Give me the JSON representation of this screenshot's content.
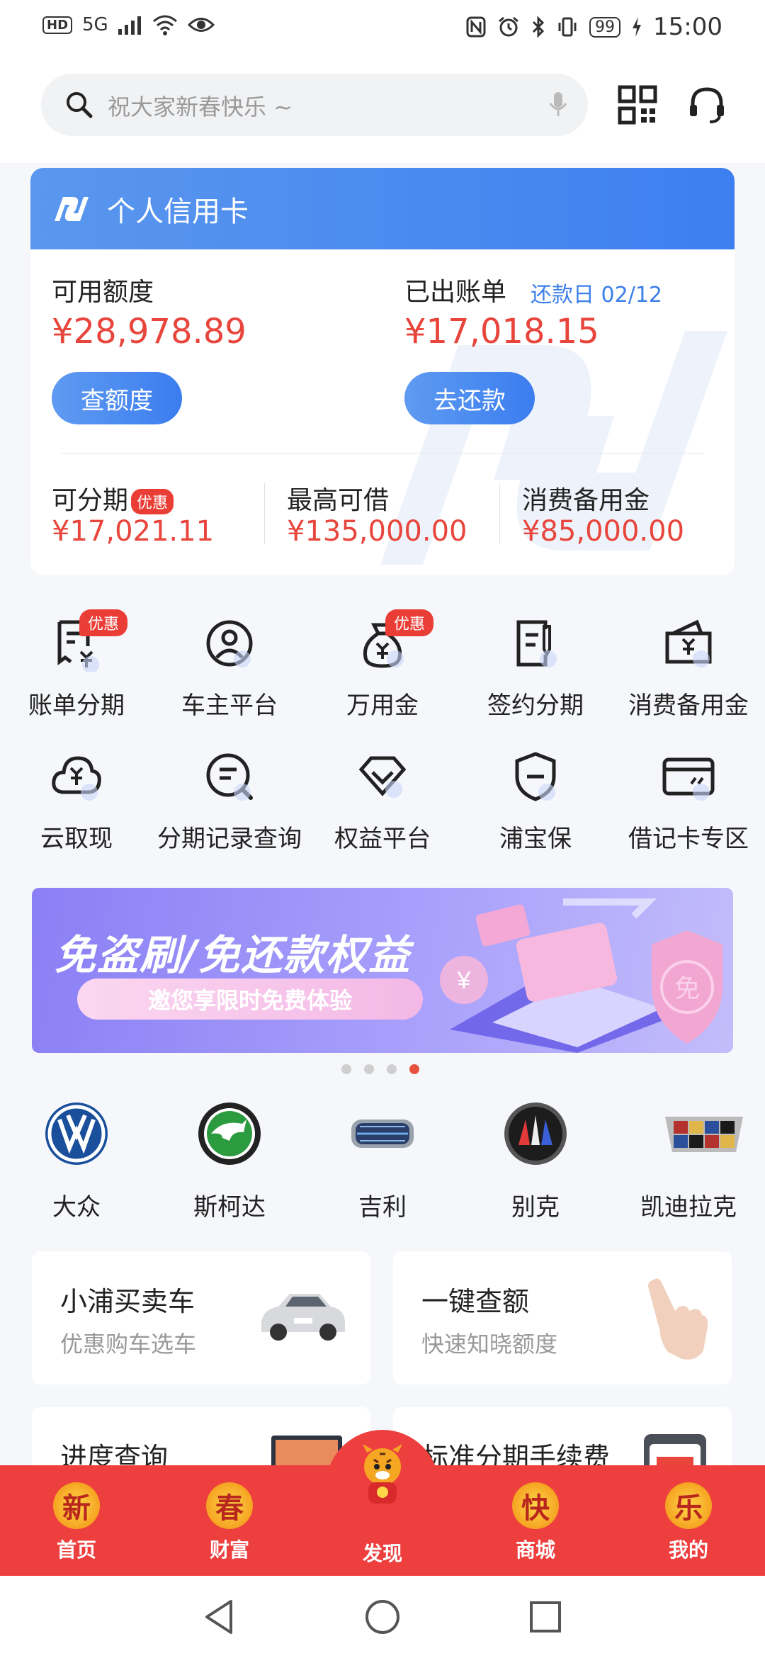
{
  "status_bar": {
    "hd_label": "HD",
    "network_label": "5G",
    "battery": "99",
    "time": "15:00"
  },
  "search": {
    "placeholder": "祝大家新春快乐 ~"
  },
  "credit_card": {
    "title": "个人信用卡",
    "available_label": "可用额度",
    "available_amount": "¥28,978.89",
    "billed_label": "已出账单",
    "due_label": "还款日 02/12",
    "billed_amount": "¥17,018.15",
    "check_limit_button": "查额度",
    "repay_button": "去还款",
    "installment_label": "可分期",
    "installment_tag": "优惠",
    "installment_amount": "¥17,021.11",
    "max_borrow_label": "最高可借",
    "max_borrow_amount": "¥135,000.00",
    "reserve_label": "消费备用金",
    "reserve_amount": "¥85,000.00"
  },
  "grid": [
    {
      "label": "账单分期",
      "icon": "bill-installment-icon",
      "badge": "优惠"
    },
    {
      "label": "车主平台",
      "icon": "car-owner-icon",
      "badge": ""
    },
    {
      "label": "万用金",
      "icon": "money-bag-icon",
      "badge": "优惠"
    },
    {
      "label": "签约分期",
      "icon": "sign-installment-icon",
      "badge": ""
    },
    {
      "label": "消费备用金",
      "icon": "wallet-icon",
      "badge": ""
    },
    {
      "label": "云取现",
      "icon": "cloud-cash-icon",
      "badge": ""
    },
    {
      "label": "分期记录查询",
      "icon": "record-search-icon",
      "badge": ""
    },
    {
      "label": "权益平台",
      "icon": "diamond-icon",
      "badge": ""
    },
    {
      "label": "浦宝保",
      "icon": "shield-icon",
      "badge": ""
    },
    {
      "label": "借记卡专区",
      "icon": "debit-card-icon",
      "badge": ""
    }
  ],
  "banner": {
    "title": "免盗刷/免还款权益",
    "subtitle": "邀您享限时免费体验",
    "badge_char": "免"
  },
  "brands": [
    {
      "name": "大众",
      "icon": "volkswagen-logo-icon"
    },
    {
      "name": "斯柯达",
      "icon": "skoda-logo-icon"
    },
    {
      "name": "吉利",
      "icon": "geely-logo-icon"
    },
    {
      "name": "别克",
      "icon": "buick-logo-icon"
    },
    {
      "name": "凯迪拉克",
      "icon": "cadillac-logo-icon"
    }
  ],
  "tiles": [
    {
      "title": "小浦买卖车",
      "subtitle": "优惠购车选车"
    },
    {
      "title": "一键查额",
      "subtitle": "快速知晓额度"
    },
    {
      "title": "进度查询",
      "subtitle": ""
    },
    {
      "title": "标准分期手续费",
      "subtitle": ""
    }
  ],
  "nav": [
    {
      "label": "首页",
      "char": "新"
    },
    {
      "label": "财富",
      "char": "春"
    },
    {
      "label": "发现",
      "char": ""
    },
    {
      "label": "商城",
      "char": "快"
    },
    {
      "label": "我的",
      "char": "乐"
    }
  ],
  "colors": {
    "accent_blue": "#3d7ff0",
    "amount_red": "#e8453c",
    "nav_red": "#ee3f3f"
  }
}
